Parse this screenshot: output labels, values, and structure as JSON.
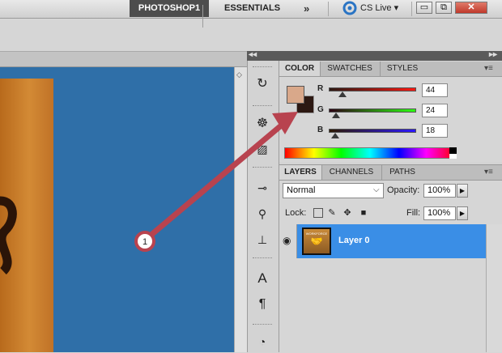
{
  "topbar": {
    "workspace": "PHOTOSHOP1",
    "essentials": "ESSENTIALS",
    "more": "»",
    "cslive": "CS Live ▾",
    "win_min": "▭",
    "win_restore": "⧉",
    "win_close": "✕"
  },
  "dock": {
    "collapse_left": "◂◂",
    "expand_right": "▸▸"
  },
  "color_panel": {
    "tabs": [
      "COLOR",
      "SWATCHES",
      "STYLES"
    ],
    "menu": "▾≡",
    "channels": [
      {
        "label": "R",
        "value": "44"
      },
      {
        "label": "G",
        "value": "24"
      },
      {
        "label": "B",
        "value": "18"
      }
    ],
    "fg_color": "#d9a88a",
    "bg_color": "#2c1812"
  },
  "layers_panel": {
    "tabs": [
      "LAYERS",
      "CHANNELS",
      "PATHS"
    ],
    "menu": "▾≡",
    "blend_mode": "Normal",
    "opacity_label": "Opacity:",
    "opacity": "100%",
    "lock_label": "Lock:",
    "fill_label": "Fill:",
    "fill": "100%",
    "layer_name": "Layer 0",
    "thumb_text": "WORKFORCE"
  },
  "annotation": {
    "number": "1",
    "color": "#b8434f"
  },
  "tools": [
    "history-icon",
    "navigator-icon",
    "image-icon",
    "brush-preset-icon",
    "clone-source-icon",
    "stamp-icon",
    "character-icon",
    "paragraph-icon",
    "nav-icon"
  ]
}
